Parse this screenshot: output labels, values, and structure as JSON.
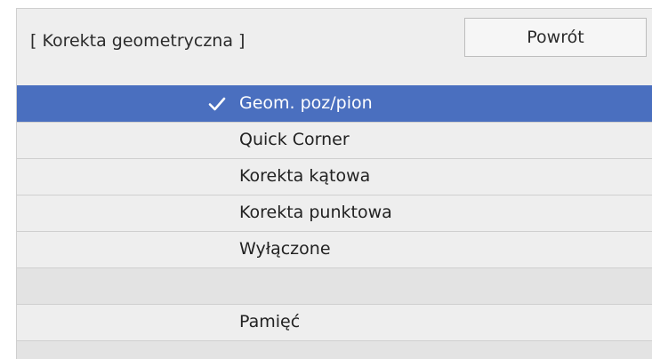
{
  "header": {
    "title": "[ Korekta geometryczna ]",
    "back_label": "Powrót"
  },
  "menu": {
    "items": [
      {
        "label": "Geom. poz/pion",
        "selected": true
      },
      {
        "label": "Quick Corner",
        "selected": false
      },
      {
        "label": "Korekta kątowa",
        "selected": false
      },
      {
        "label": "Korekta punktowa",
        "selected": false
      },
      {
        "label": "Wyłączone",
        "selected": false
      },
      {
        "label": "",
        "selected": false
      },
      {
        "label": "Pamięć",
        "selected": false
      }
    ]
  },
  "icons": {
    "selected_marker": "check-icon"
  },
  "colors": {
    "selection": "#4a6fbf",
    "panel": "#eeeeee"
  }
}
